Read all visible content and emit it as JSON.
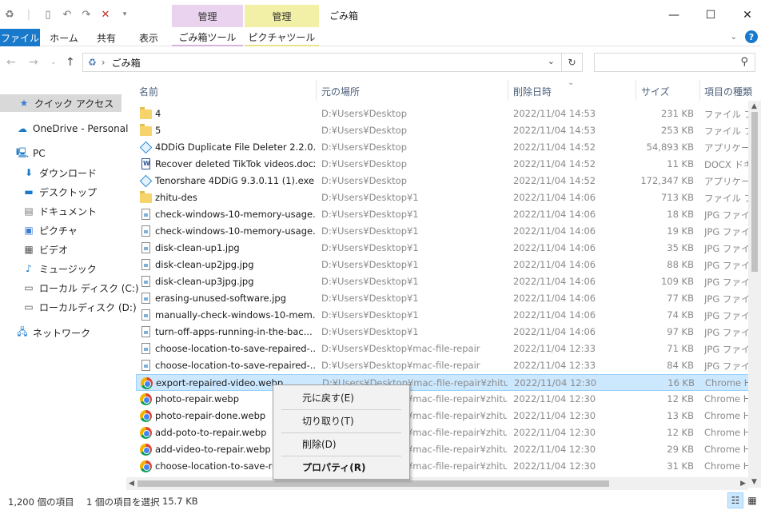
{
  "window": {
    "title": "ごみ箱",
    "context_tab_1": "管理",
    "context_tab_2": "管理"
  },
  "ribbon": {
    "tabs": [
      "ファイル",
      "ホーム",
      "共有",
      "表示",
      "ごみ箱ツール",
      "ピクチャツール"
    ]
  },
  "address": {
    "path": "ごみ箱",
    "search_placeholder": ""
  },
  "nav": [
    {
      "label": "クイック アクセス",
      "icon": "star-icon"
    },
    {
      "label": "OneDrive - Personal",
      "icon": "cloud-icon"
    },
    {
      "label": "PC",
      "icon": "computer-icon"
    },
    {
      "label": "ダウンロード",
      "icon": "download-icon"
    },
    {
      "label": "デスクトップ",
      "icon": "desktop-icon"
    },
    {
      "label": "ドキュメント",
      "icon": "document-icon"
    },
    {
      "label": "ピクチャ",
      "icon": "picture-icon"
    },
    {
      "label": "ビデオ",
      "icon": "video-icon"
    },
    {
      "label": "ミュージック",
      "icon": "music-icon"
    },
    {
      "label": "ローカル ディスク (C:)",
      "icon": "drive-icon"
    },
    {
      "label": "ローカルディスク (D:)",
      "icon": "drive-icon"
    },
    {
      "label": "ネットワーク",
      "icon": "network-icon"
    }
  ],
  "columns": {
    "name": "名前",
    "location": "元の場所",
    "deleted": "削除日時",
    "size": "サイズ",
    "type": "項目の種類"
  },
  "files": [
    {
      "name": "4",
      "loc": "D:¥Users¥Desktop",
      "date": "2022/11/04 14:53",
      "size": "231 KB",
      "type": "ファイル フォルダー",
      "kind": "folder"
    },
    {
      "name": "5",
      "loc": "D:¥Users¥Desktop",
      "date": "2022/11/04 14:53",
      "size": "253 KB",
      "type": "ファイル フォルダー",
      "kind": "folder"
    },
    {
      "name": "4DDiG Duplicate File Deleter 2.2.0.6...",
      "loc": "D:¥Users¥Desktop",
      "date": "2022/11/04 14:52",
      "size": "54,893 KB",
      "type": "アプリケーション",
      "kind": "exe"
    },
    {
      "name": "Recover deleted TikTok videos.docx",
      "loc": "D:¥Users¥Desktop",
      "date": "2022/11/04 14:52",
      "size": "11 KB",
      "type": "DOCX ドキュメント",
      "kind": "docx"
    },
    {
      "name": "Tenorshare 4DDiG 9.3.0.11 (1).exe",
      "loc": "D:¥Users¥Desktop",
      "date": "2022/11/04 14:52",
      "size": "172,347 KB",
      "type": "アプリケーション",
      "kind": "exe"
    },
    {
      "name": "zhitu-des",
      "loc": "D:¥Users¥Desktop¥1",
      "date": "2022/11/04 14:06",
      "size": "713 KB",
      "type": "ファイル フォルダー",
      "kind": "folder"
    },
    {
      "name": "check-windows-10-memory-usage...",
      "loc": "D:¥Users¥Desktop¥1",
      "date": "2022/11/04 14:06",
      "size": "18 KB",
      "type": "JPG ファイル",
      "kind": "jpg"
    },
    {
      "name": "check-windows-10-memory-usage...",
      "loc": "D:¥Users¥Desktop¥1",
      "date": "2022/11/04 14:06",
      "size": "19 KB",
      "type": "JPG ファイル",
      "kind": "jpg"
    },
    {
      "name": "disk-clean-up1.jpg",
      "loc": "D:¥Users¥Desktop¥1",
      "date": "2022/11/04 14:06",
      "size": "35 KB",
      "type": "JPG ファイル",
      "kind": "jpg"
    },
    {
      "name": "disk-clean-up2jpg.jpg",
      "loc": "D:¥Users¥Desktop¥1",
      "date": "2022/11/04 14:06",
      "size": "88 KB",
      "type": "JPG ファイル",
      "kind": "jpg"
    },
    {
      "name": "disk-clean-up3jpg.jpg",
      "loc": "D:¥Users¥Desktop¥1",
      "date": "2022/11/04 14:06",
      "size": "109 KB",
      "type": "JPG ファイル",
      "kind": "jpg"
    },
    {
      "name": "erasing-unused-software.jpg",
      "loc": "D:¥Users¥Desktop¥1",
      "date": "2022/11/04 14:06",
      "size": "77 KB",
      "type": "JPG ファイル",
      "kind": "jpg"
    },
    {
      "name": "manually-check-windows-10-mem...",
      "loc": "D:¥Users¥Desktop¥1",
      "date": "2022/11/04 14:06",
      "size": "74 KB",
      "type": "JPG ファイル",
      "kind": "jpg"
    },
    {
      "name": "turn-off-apps-running-in-the-bac...",
      "loc": "D:¥Users¥Desktop¥1",
      "date": "2022/11/04 14:06",
      "size": "97 KB",
      "type": "JPG ファイル",
      "kind": "jpg"
    },
    {
      "name": "choose-location-to-save-repaired-...",
      "loc": "D:¥Users¥Desktop¥mac-file-repair",
      "date": "2022/11/04 12:33",
      "size": "71 KB",
      "type": "JPG ファイル",
      "kind": "jpg"
    },
    {
      "name": "choose-location-to-save-repaired-...",
      "loc": "D:¥Users¥Desktop¥mac-file-repair",
      "date": "2022/11/04 12:33",
      "size": "84 KB",
      "type": "JPG ファイル",
      "kind": "jpg"
    },
    {
      "name": "export-repaired-video.webp",
      "loc": "D:¥Users¥Desktop¥mac-file-repair¥zhitu-...",
      "date": "2022/11/04 12:30",
      "size": "16 KB",
      "type": "Chrome HTML",
      "kind": "chrome",
      "selected": true
    },
    {
      "name": "photo-repair.webp",
      "loc": "D:¥Users¥Desktop¥mac-file-repair¥zhitu-...",
      "date": "2022/11/04 12:30",
      "size": "12 KB",
      "type": "Chrome HTML",
      "kind": "chrome"
    },
    {
      "name": "photo-repair-done.webp",
      "loc": "D:¥Users¥Desktop¥mac-file-repair¥zhitu-...",
      "date": "2022/11/04 12:30",
      "size": "13 KB",
      "type": "Chrome HTML",
      "kind": "chrome"
    },
    {
      "name": "add-poto-to-repair.webp",
      "loc": "D:¥Users¥Desktop¥mac-file-repair¥zhitu-...",
      "date": "2022/11/04 12:30",
      "size": "12 KB",
      "type": "Chrome HTML",
      "kind": "chrome"
    },
    {
      "name": "add-video-to-repair.webp",
      "loc": "D:¥Users¥Desktop¥mac-file-repair¥zhitu-...",
      "date": "2022/11/04 12:30",
      "size": "29 KB",
      "type": "Chrome HTML",
      "kind": "chrome"
    },
    {
      "name": "choose-location-to-save-rep...",
      "loc": "D:¥Users¥Desktop¥mac-file-repair¥zhitu-...",
      "date": "2022/11/04 12:30",
      "size": "31 KB",
      "type": "Chrome HTML",
      "kind": "chrome"
    }
  ],
  "context_menu": [
    {
      "label": "元に戻す(E)",
      "bold": false
    },
    {
      "label": "切り取り(T)",
      "bold": false
    },
    {
      "label": "削除(D)",
      "bold": false
    },
    {
      "label": "プロパティ(R)",
      "bold": true
    }
  ],
  "status": {
    "count": "1,200 個の項目",
    "selection": "1 個の項目を選択",
    "selection_size": "15.7 KB"
  },
  "colors": {
    "accent": "#1979ca",
    "selection": "#cce8ff",
    "manage_tab_1": "#ead3ee",
    "manage_tab_2": "#f1f0a6"
  }
}
